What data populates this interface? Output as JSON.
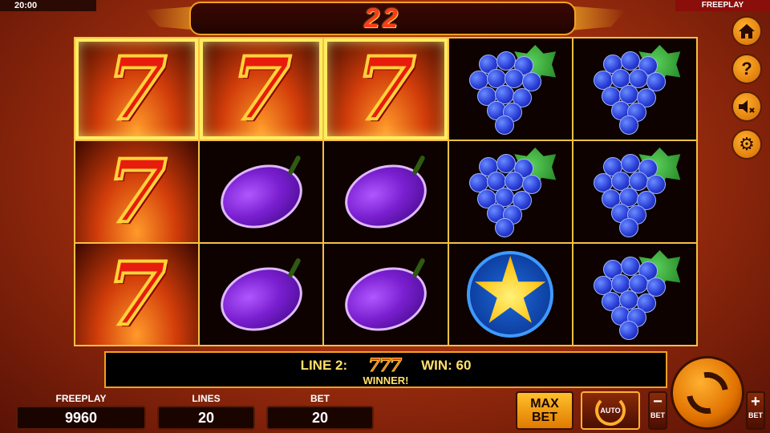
{
  "status": {
    "clock": "20:00",
    "mode": "FREEPLAY"
  },
  "counter": {
    "value": "22"
  },
  "reels": [
    [
      "seven",
      "seven",
      "seven"
    ],
    [
      "seven",
      "plum",
      "plum"
    ],
    [
      "seven",
      "plum",
      "plum"
    ],
    [
      "grapes",
      "grapes",
      "star"
    ],
    [
      "grapes",
      "grapes",
      "grapes"
    ]
  ],
  "winning_cells": [
    [
      0,
      0
    ],
    [
      1,
      0
    ],
    [
      2,
      0
    ]
  ],
  "symbols": {
    "seven": "7"
  },
  "win_banner": {
    "line_label": "LINE 2:",
    "line_symbols": "777",
    "win_label": "WIN: 60",
    "winner_text": "WINNER!"
  },
  "stats": {
    "freeplay_label": "FREEPLAY",
    "freeplay_value": "9960",
    "lines_label": "LINES",
    "lines_value": "20",
    "bet_label": "BET",
    "bet_value": "20"
  },
  "controls": {
    "maxbet_line1": "MAX",
    "maxbet_line2": "BET",
    "auto_label": "AUTO",
    "bet_minus_sign": "−",
    "bet_plus_sign": "+",
    "bet_minus_label": "BET",
    "bet_plus_label": "BET"
  },
  "side_buttons": [
    {
      "name": "home-button",
      "icon": "home-icon"
    },
    {
      "name": "help-button",
      "icon": "question-icon",
      "glyph": "?"
    },
    {
      "name": "sound-button",
      "icon": "sound-muted-icon"
    },
    {
      "name": "settings-button",
      "icon": "gear-icon",
      "glyph": "⚙"
    }
  ],
  "colors": {
    "accent": "#f2a020",
    "counter_text": "#ff3a1a",
    "win_text": "#ffe06a"
  }
}
